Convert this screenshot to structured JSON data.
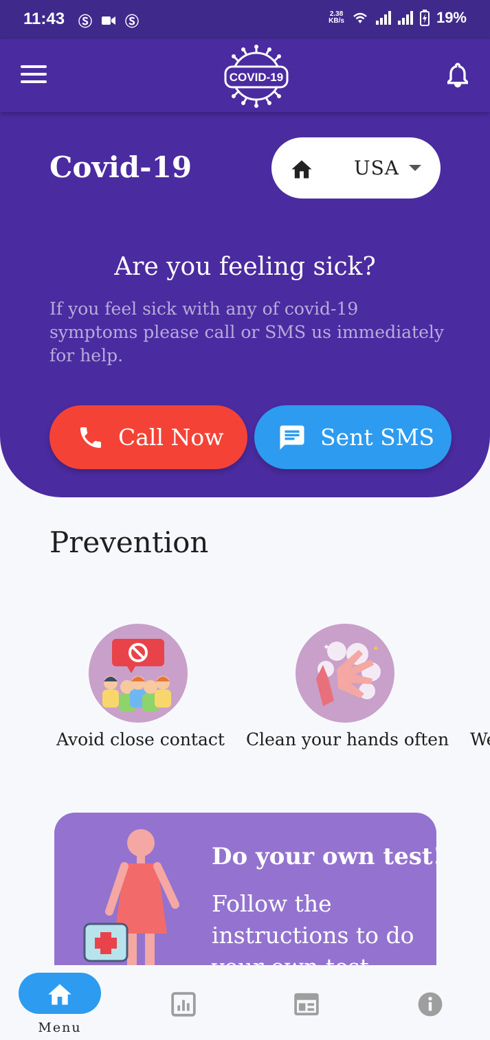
{
  "status_bar": {
    "time": "11:43",
    "net_speed_value": "2.38",
    "net_speed_unit": "KB/s",
    "battery": "19%"
  },
  "app_bar": {
    "logo_text": "COVID-19"
  },
  "hero": {
    "title": "Covid-19",
    "country": "USA",
    "question": "Are you feeling sick?",
    "description": "If you feel sick with any of covid-19 symptoms please call or SMS us immediately for help.",
    "call_label": "Call Now",
    "sms_label": "Sent SMS"
  },
  "prevention": {
    "title": "Prevention",
    "items": [
      {
        "label": "Avoid close contact"
      },
      {
        "label": "Clean your hands often"
      },
      {
        "label": "We"
      }
    ]
  },
  "test_card": {
    "title": "Do your own test!",
    "description": "Follow the instructions to do your own test"
  },
  "bottom_nav": {
    "home_label": "Menu"
  },
  "colors": {
    "primary": "#4B2BA0",
    "call": "#F44336",
    "sms": "#2D9BF0",
    "card": "#9373CF"
  }
}
